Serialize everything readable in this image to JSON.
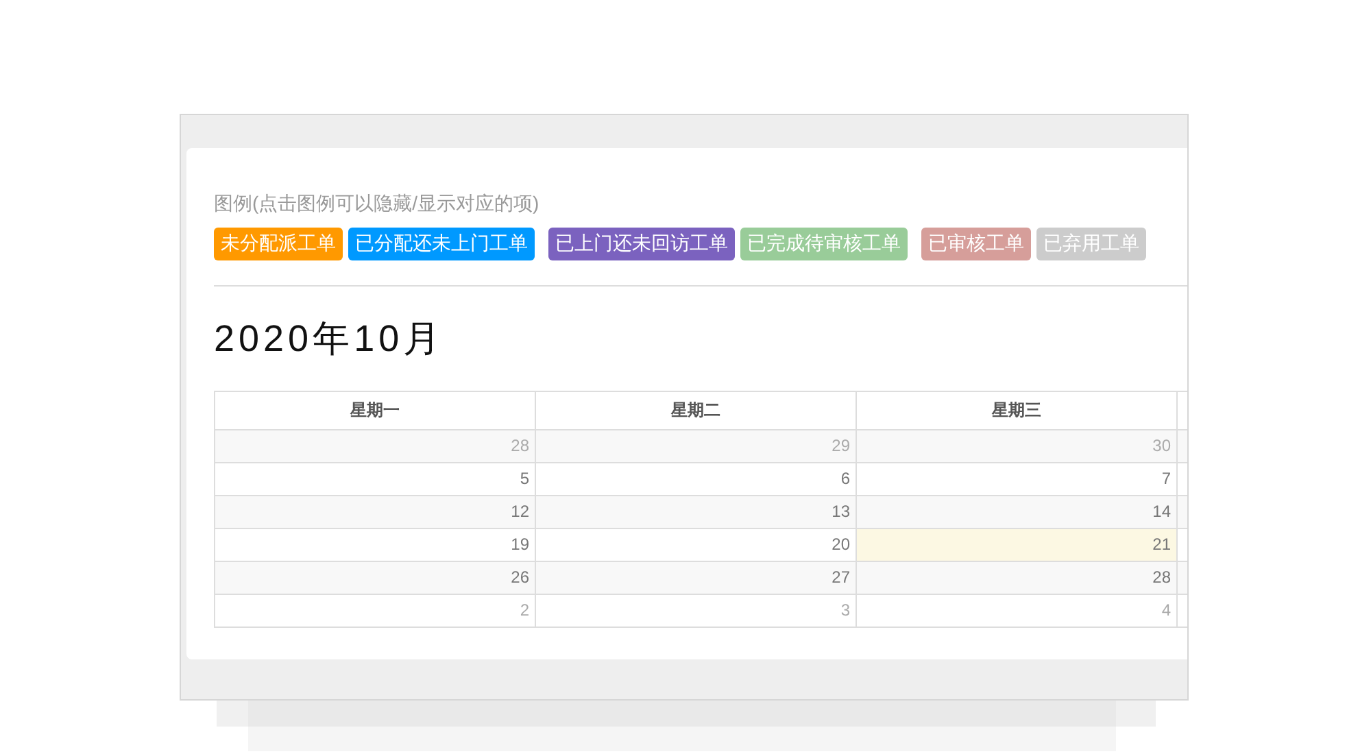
{
  "legend": {
    "title": "图例(点击图例可以隐藏/显示对应的项)",
    "items": [
      {
        "label": "未分配派工单",
        "color": "#ff9900"
      },
      {
        "label": "已分配还未上门工单",
        "color": "#0099ff"
      },
      {
        "label": "已上门还未回访工单",
        "color": "#7b62bf"
      },
      {
        "label": "已完成待审核工单",
        "color": "#99cc99"
      },
      {
        "label": "已审核工单",
        "color": "#d69e9a"
      },
      {
        "label": "已弃用工单",
        "color": "#cccccc"
      }
    ]
  },
  "calendar": {
    "title": "2020年10月",
    "columns": [
      "星期一",
      "星期二",
      "星期三"
    ],
    "weeks": [
      [
        {
          "day": "28",
          "other_month": true,
          "today": false
        },
        {
          "day": "29",
          "other_month": true,
          "today": false
        },
        {
          "day": "30",
          "other_month": true,
          "today": false
        }
      ],
      [
        {
          "day": "5",
          "other_month": false,
          "today": false
        },
        {
          "day": "6",
          "other_month": false,
          "today": false
        },
        {
          "day": "7",
          "other_month": false,
          "today": false
        }
      ],
      [
        {
          "day": "12",
          "other_month": false,
          "today": false
        },
        {
          "day": "13",
          "other_month": false,
          "today": false
        },
        {
          "day": "14",
          "other_month": false,
          "today": false
        }
      ],
      [
        {
          "day": "19",
          "other_month": false,
          "today": false
        },
        {
          "day": "20",
          "other_month": false,
          "today": false
        },
        {
          "day": "21",
          "other_month": false,
          "today": true
        }
      ],
      [
        {
          "day": "26",
          "other_month": false,
          "today": false
        },
        {
          "day": "27",
          "other_month": false,
          "today": false
        },
        {
          "day": "28",
          "other_month": false,
          "today": false
        }
      ],
      [
        {
          "day": "2",
          "other_month": true,
          "today": false
        },
        {
          "day": "3",
          "other_month": true,
          "today": false
        },
        {
          "day": "4",
          "other_month": true,
          "today": false
        }
      ]
    ]
  }
}
